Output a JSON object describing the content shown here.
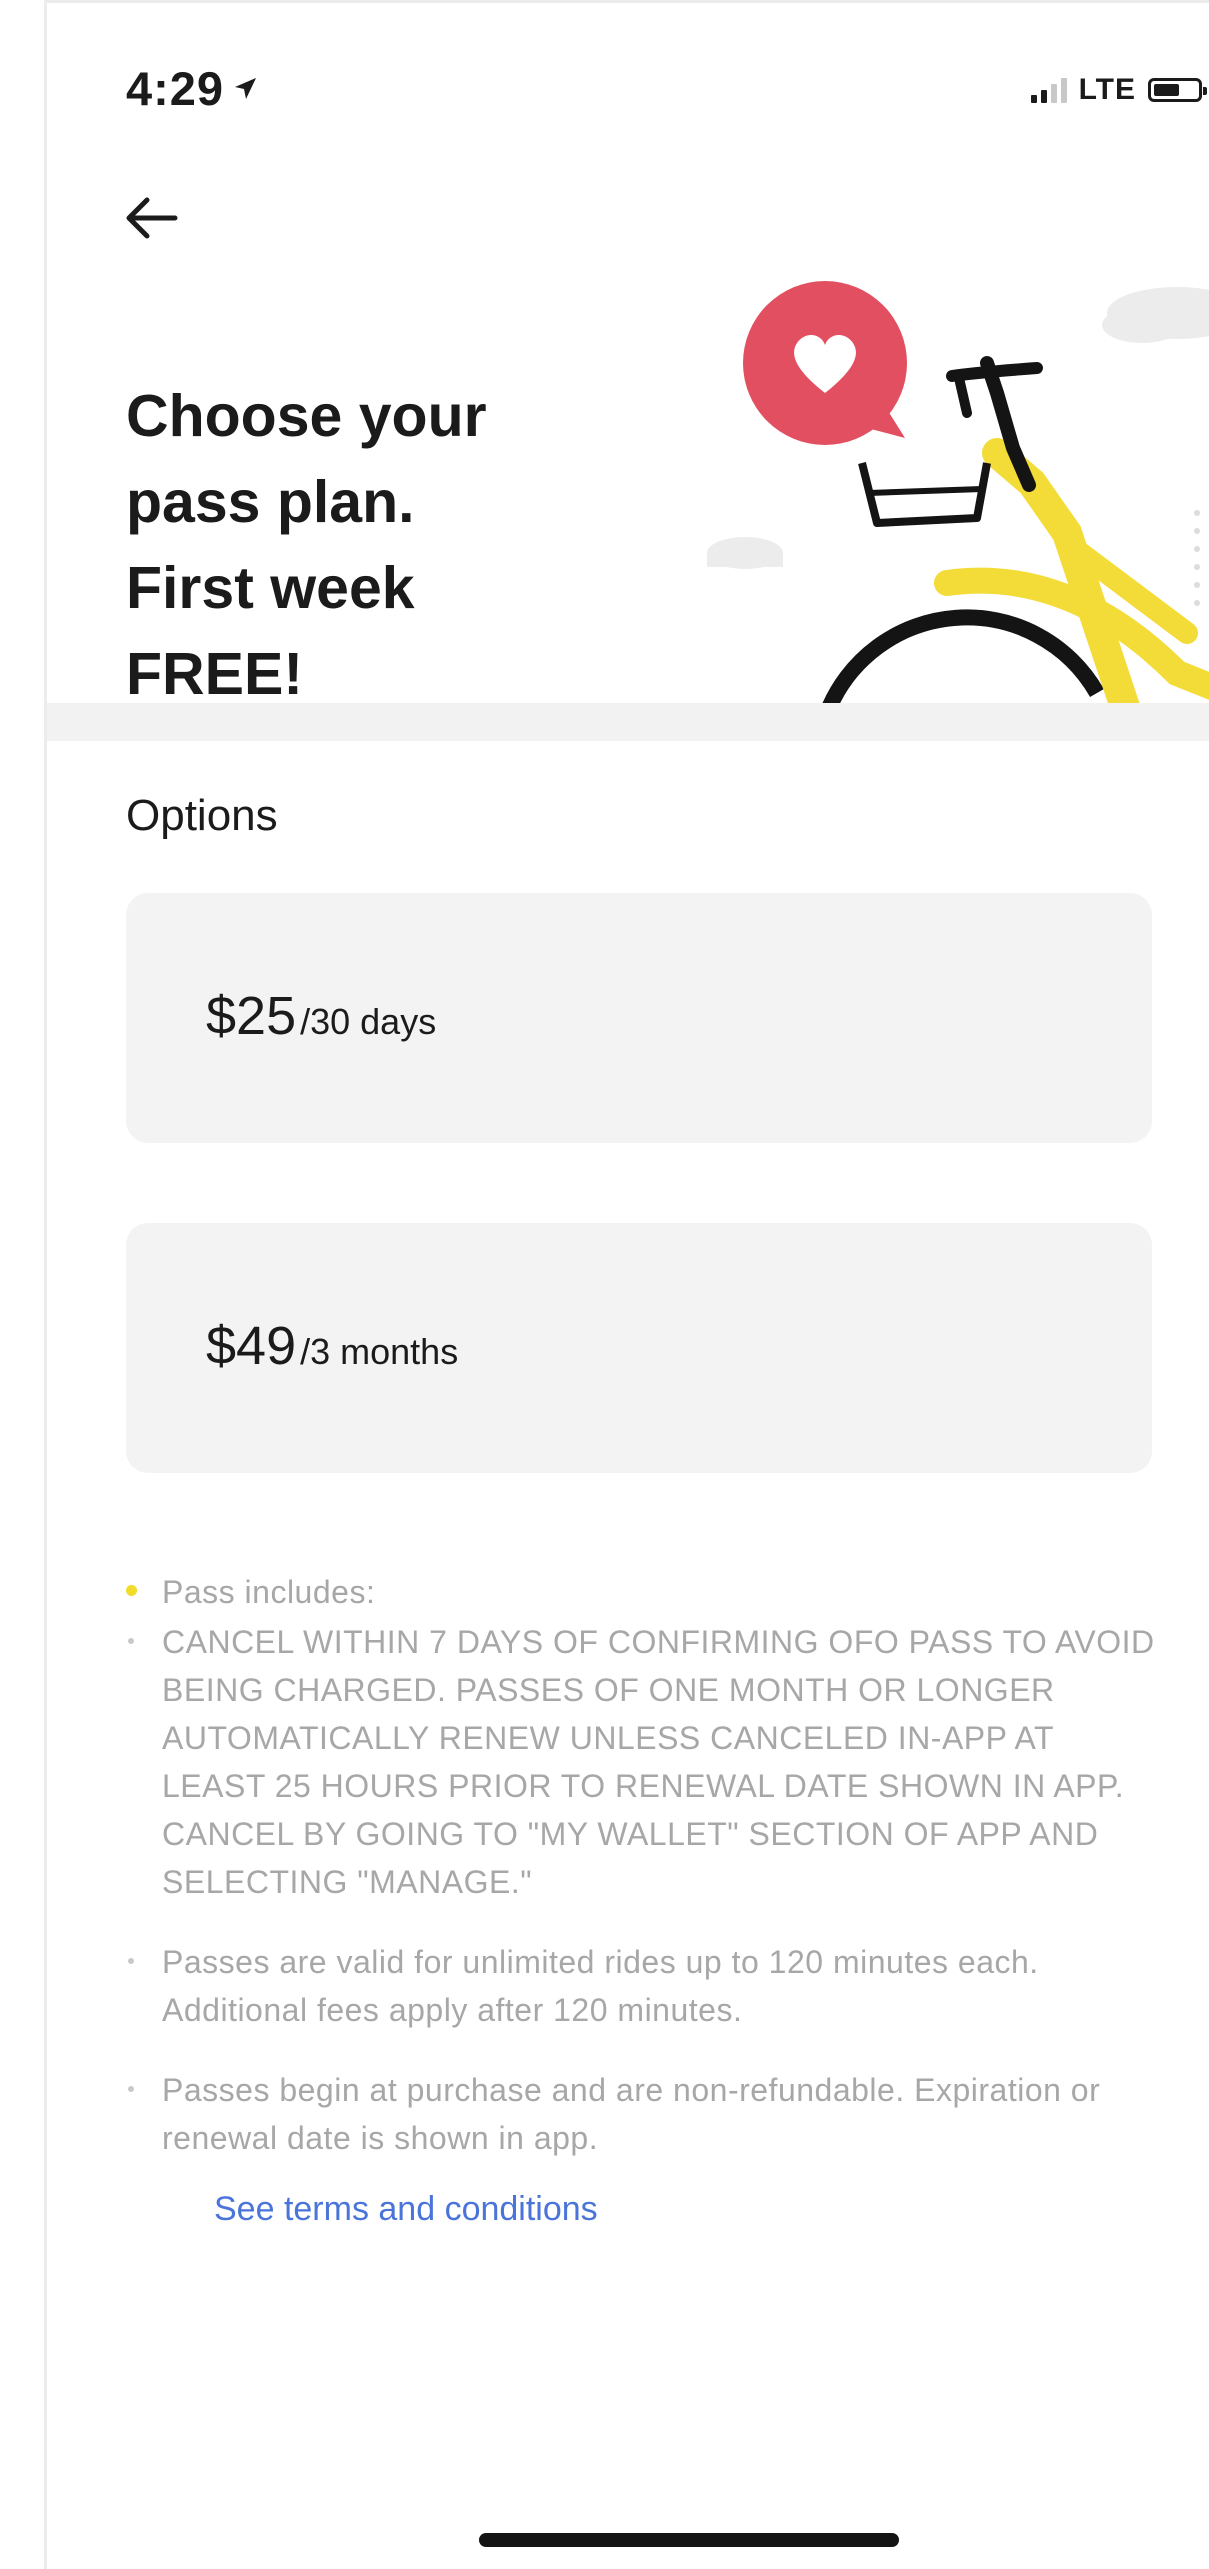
{
  "status_bar": {
    "time": "4:29",
    "network": "LTE",
    "location_icon": "location-arrow-icon",
    "signal_icon": "signal-bars-icon",
    "battery_icon": "battery-icon"
  },
  "header": {
    "back_icon": "arrow-left-icon",
    "title": "Choose your pass plan. First week FREE!"
  },
  "hero": {
    "illustration": "bike-with-heart-illustration",
    "accent_color": "#f3dc38",
    "heart_bubble_color": "#e24f60"
  },
  "options": {
    "heading": "Options",
    "items": [
      {
        "price": "$25",
        "period": "/30 days"
      },
      {
        "price": "$49",
        "period": "/3 months"
      }
    ]
  },
  "info": {
    "intro": "Pass includes:",
    "items": [
      "CANCEL WITHIN 7 DAYS OF CONFIRMING OFO PASS TO AVOID BEING CHARGED. PASSES OF ONE MONTH OR LONGER AUTOMATICALLY RENEW UNLESS CANCELED IN-APP AT LEAST 25 HOURS PRIOR TO RENEWAL DATE SHOWN IN APP. CANCEL BY GOING TO \"MY WALLET\" SECTION OF APP AND SELECTING \"MANAGE.\"",
      "Passes are valid for unlimited rides up to 120 minutes each.  Additional fees apply after 120 minutes.",
      "Passes begin at purchase and are non-refundable. Expiration or renewal date is shown in app."
    ],
    "terms_link": "See terms and conditions",
    "link_color": "#4a74d9"
  }
}
